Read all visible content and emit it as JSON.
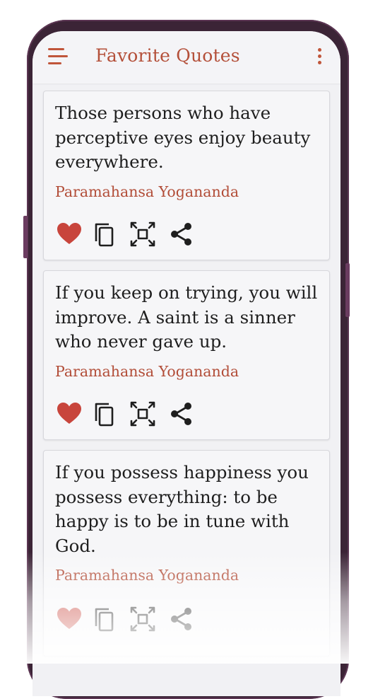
{
  "appbar": {
    "title": "Favorite Quotes",
    "menu_icon": "hamburger-menu-icon",
    "more_icon": "more-vertical-icon"
  },
  "colors": {
    "accent": "#b4503a",
    "heart": "#c8453c",
    "icon": "#1e1e1e",
    "card_bg": "#f6f6f8",
    "screen_bg": "#f1f1f4"
  },
  "quotes": [
    {
      "lines": [
        "Those persons who have",
        "perceptive eyes enjoy beauty",
        "everywhere."
      ],
      "author": "Paramahansa Yogananda",
      "favorite": true
    },
    {
      "lines": [
        "If you keep on trying, you will",
        "improve. A saint is a sinner",
        "who never gave up."
      ],
      "author": "Paramahansa Yogananda",
      "favorite": true
    },
    {
      "lines": [
        "If you possess happiness you",
        "possess everything: to be",
        "happy is to be in tune with",
        "God."
      ],
      "author": "Paramahansa Yogananda",
      "favorite": true
    }
  ],
  "action_icons": [
    "heart-icon",
    "copy-icon",
    "fullscreen-icon",
    "share-icon"
  ]
}
